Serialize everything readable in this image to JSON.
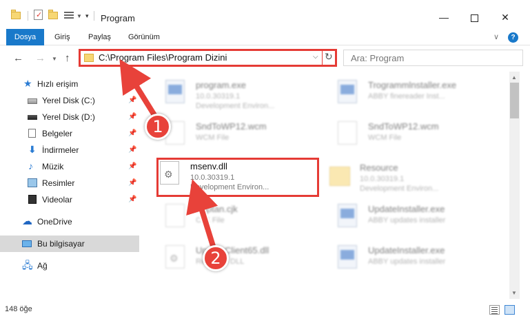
{
  "window": {
    "title": "Program",
    "controls": {
      "minimize": "—",
      "maximize": "",
      "close": "✕"
    }
  },
  "ribbon": {
    "tabs": [
      "Dosya",
      "Giriş",
      "Paylaş",
      "Görünüm"
    ],
    "help": "?"
  },
  "nav": {
    "address": "C:\\Program Files\\Program Dizini",
    "search_placeholder": "Ara: Program"
  },
  "sidebar": {
    "items": [
      {
        "label": "Hızlı erişim",
        "icon": "star-icon"
      },
      {
        "label": "Yerel Disk (C:)",
        "icon": "drive-icon",
        "pinned": true
      },
      {
        "label": "Yerel Disk (D:)",
        "icon": "drive-icon",
        "pinned": true
      },
      {
        "label": "Belgeler",
        "icon": "documents-icon",
        "pinned": true
      },
      {
        "label": "İndirmeler",
        "icon": "downloads-icon",
        "pinned": true
      },
      {
        "label": "Müzik",
        "icon": "music-icon",
        "pinned": true
      },
      {
        "label": "Resimler",
        "icon": "pictures-icon",
        "pinned": true
      },
      {
        "label": "Videolar",
        "icon": "videos-icon",
        "pinned": true
      },
      {
        "label": "OneDrive",
        "icon": "cloud-icon"
      },
      {
        "label": "Bu bilgisayar",
        "icon": "computer-icon",
        "selected": true
      },
      {
        "label": "Ağ",
        "icon": "network-icon"
      }
    ]
  },
  "files": [
    {
      "name": "program.exe",
      "line2": "10.0.30319.1",
      "line3": "Development Environ...",
      "icon": "exe"
    },
    {
      "name": "Trogrammlnstaller.exe",
      "line2": "ABBY finereader Inst...",
      "line3": "",
      "icon": "exe"
    },
    {
      "name": "SndToWP12.wcm",
      "line2": "WCM File",
      "line3": "",
      "icon": "doc"
    },
    {
      "name": "SndToWP12.wcm",
      "line2": "WCM File",
      "line3": "",
      "icon": "doc"
    },
    {
      "name": "msenv.dll",
      "line2": "10.0.30319.1",
      "line3": "Development Environ...",
      "icon": "gear"
    },
    {
      "name": "Resource",
      "line2": "10.0.30319.1",
      "line3": "Development Environ...",
      "icon": "folder"
    },
    {
      "name": "Kaptan.cjk",
      "line2": "CJK File",
      "line3": "",
      "icon": "doc"
    },
    {
      "name": "UpdateInstaller.exe",
      "line2": "ABBY updates installer",
      "line3": "",
      "icon": "exe"
    },
    {
      "name": "UpdateClient65.dll",
      "line2": "Resource DLL",
      "line3": "",
      "icon": "gear"
    },
    {
      "name": "UpdateInstaller.exe",
      "line2": "ABBY updates installer",
      "line3": "",
      "icon": "exe"
    }
  ],
  "status": {
    "count": "148 öğe"
  },
  "annotations": {
    "step1": "1",
    "step2": "2"
  },
  "colors": {
    "accent": "#1979ca",
    "highlight": "#e53b35"
  }
}
